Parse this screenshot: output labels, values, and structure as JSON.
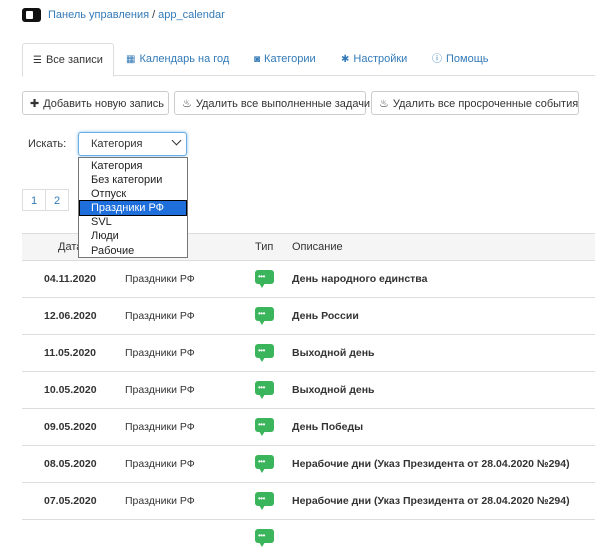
{
  "header": {
    "breadcrumb_root": "Панель управления",
    "separator": "/",
    "breadcrumb_current": "app_calendar"
  },
  "tabs": [
    {
      "label": "Все записи",
      "icon": "list-icon",
      "active": true
    },
    {
      "label": "Календарь на год",
      "icon": "calendar-icon",
      "active": false
    },
    {
      "label": "Категории",
      "icon": "inbox-icon",
      "active": false
    },
    {
      "label": "Настройки",
      "icon": "gear-icon",
      "active": false
    },
    {
      "label": "Помощь",
      "icon": "info-icon",
      "active": false
    }
  ],
  "actions": {
    "add": "Добавить новую запись",
    "delete_done": "Удалить все выполненные задачи",
    "delete_overdue": "Удалить все просроченные события"
  },
  "search": {
    "label": "Искать:",
    "selected": "Категория",
    "options": [
      "Категория",
      "Без категории",
      "Отпуск",
      "Праздники РФ",
      "SVL",
      "Люди",
      "Рабочие"
    ],
    "highlighted_index": 3
  },
  "pagination": [
    "1",
    "2"
  ],
  "table": {
    "headers": {
      "date": "Дата",
      "type": "Тип",
      "description": "Описание"
    },
    "rows": [
      {
        "date": "04.11.2020",
        "category": "Праздники РФ",
        "description": "День народного единства"
      },
      {
        "date": "12.06.2020",
        "category": "Праздники РФ",
        "description": "День России"
      },
      {
        "date": "11.05.2020",
        "category": "Праздники РФ",
        "description": "Выходной день"
      },
      {
        "date": "10.05.2020",
        "category": "Праздники РФ",
        "description": "Выходной день"
      },
      {
        "date": "09.05.2020",
        "category": "Праздники РФ",
        "description": "День Победы"
      },
      {
        "date": "08.05.2020",
        "category": "Праздники РФ",
        "description": "Нерабочие дни (Указ Президента от 28.04.2020 №294)"
      },
      {
        "date": "07.05.2020",
        "category": "Праздники РФ",
        "description": "Нерабочие дни (Указ Президента от 28.04.2020 №294)"
      }
    ]
  },
  "colors": {
    "link": "#337ab7",
    "type_icon": "#3bb55b",
    "highlight": "#1e6fdb"
  }
}
